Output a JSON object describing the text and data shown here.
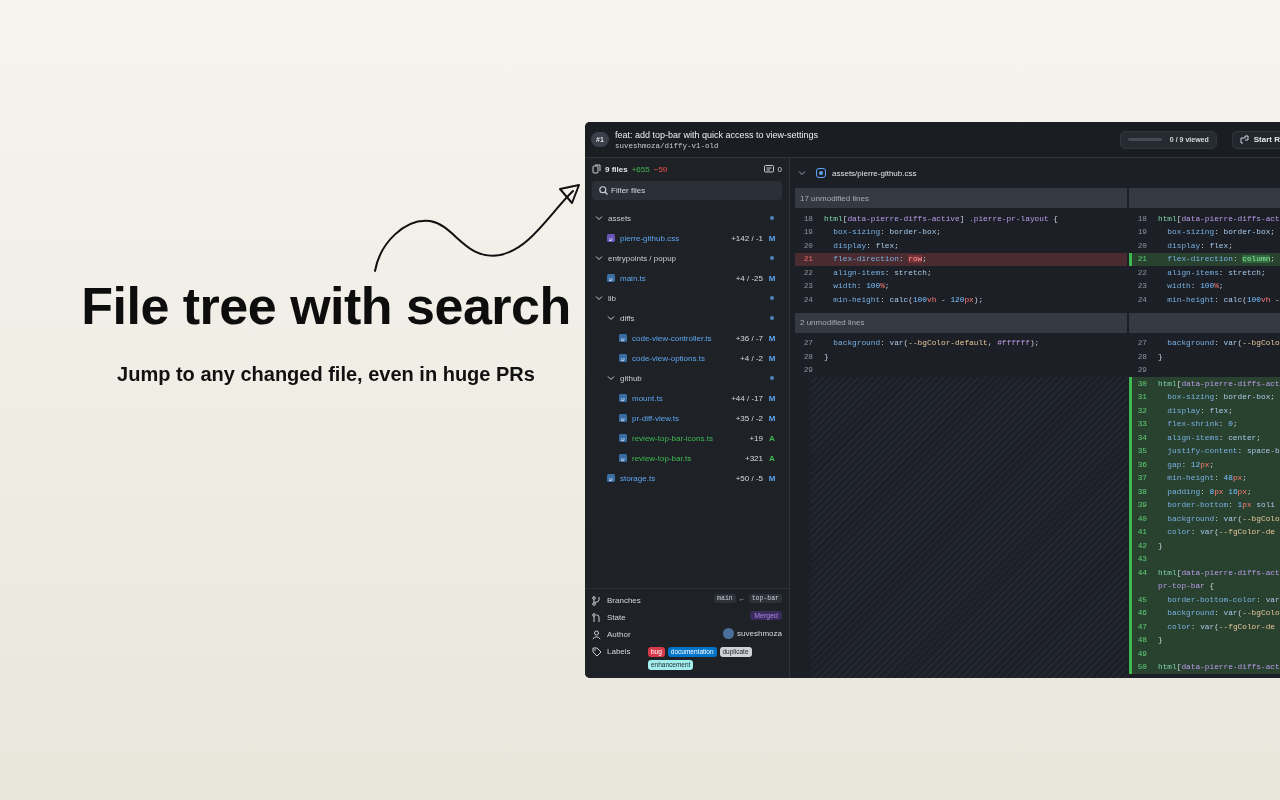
{
  "hero": {
    "title": "File tree with search",
    "subtitle": "Jump to any changed file, even in huge PRs"
  },
  "header": {
    "number": "#1",
    "title": "feat: add top-bar with quick access to view-settings",
    "repo": "suveshmoza/diffy-v1-old",
    "progress": {
      "level": 0,
      "label": "0 / 9 viewed"
    },
    "action": "Start R"
  },
  "sidebar": {
    "file_count": "9 files",
    "additions": "+655",
    "deletions": "−59",
    "comments": "0",
    "filter": {
      "placeholder": "Filter files"
    },
    "tree": [
      {
        "name": "assets",
        "kind": "folder",
        "expanded": true,
        "children": [
          {
            "name": "pierre-github.css",
            "kind": "stylesheet",
            "added": false,
            "stats": "+142 / -1",
            "status": "M"
          }
        ]
      },
      {
        "name": "entrypoints / popup",
        "kind": "folder",
        "expanded": true,
        "children": [
          {
            "name": "main.ts",
            "kind": "script",
            "added": false,
            "stats": "+4 / -25",
            "status": "M"
          }
        ]
      },
      {
        "name": "lib",
        "kind": "folder",
        "expanded": true,
        "children": [
          {
            "name": "diffs",
            "kind": "folder",
            "expanded": true,
            "children": [
              {
                "name": "code-view-controller.ts",
                "kind": "script",
                "added": false,
                "stats": "+36 / -7",
                "status": "M"
              },
              {
                "name": "code-view-options.ts",
                "kind": "script",
                "added": false,
                "stats": "+4 / -2",
                "status": "M"
              }
            ]
          },
          {
            "name": "github",
            "kind": "folder",
            "expanded": true,
            "children": [
              {
                "name": "mount.ts",
                "kind": "script",
                "added": false,
                "stats": "+44 / -17",
                "status": "M"
              },
              {
                "name": "pr-diff-view.ts",
                "kind": "script",
                "added": false,
                "stats": "+35 / -2",
                "status": "M"
              },
              {
                "name": "review-top-bar-icons.ts",
                "kind": "script",
                "added": true,
                "stats": "+19",
                "status": "A"
              },
              {
                "name": "review-top-bar.ts",
                "kind": "script",
                "added": true,
                "stats": "+321",
                "status": "A"
              }
            ]
          },
          {
            "name": "storage.ts",
            "kind": "script",
            "added": false,
            "stats": "+50 / -5",
            "status": "M"
          }
        ]
      }
    ],
    "details": [
      {
        "kind": "branches",
        "label": "Branches",
        "base": "main",
        "arrow": "←",
        "head": "top-bar"
      },
      {
        "kind": "state",
        "label": "State",
        "value": "Merged"
      },
      {
        "kind": "author",
        "label": "Author",
        "value": "suveshmoza"
      },
      {
        "kind": "labels",
        "label": "Labels",
        "labels": [
          {
            "text": "bug",
            "color": "#d73a4a"
          },
          {
            "text": "documentation",
            "color": "#0075ca"
          },
          {
            "text": "duplicate",
            "color": "#cfd3d7"
          },
          {
            "text": "enhancement",
            "color": "#a2eeef"
          }
        ]
      }
    ]
  },
  "diff": {
    "file": {
      "path": "assets/pierre-github.css",
      "expanded": true
    },
    "left": [
      {
        "kind": "collapsed",
        "label": "17 unmodified lines"
      },
      {
        "kind": "context",
        "n": "18",
        "t": [
          {
            "kind": "tag",
            "text": "html"
          },
          {
            "kind": "p",
            "text": "["
          },
          {
            "kind": "attr",
            "text": "data-pierre-diffs-active"
          },
          {
            "kind": "p",
            "text": "] "
          },
          {
            "kind": "cls",
            "text": ".pierre-pr-layout"
          },
          {
            "kind": "p",
            "text": " {"
          }
        ]
      },
      {
        "kind": "context",
        "n": "19",
        "t": [
          {
            "kind": "prop",
            "text": "  box-sizing"
          },
          {
            "kind": "p",
            "text": ": "
          },
          {
            "kind": "val",
            "text": "border-box"
          },
          {
            "kind": "p",
            "text": ";"
          }
        ]
      },
      {
        "kind": "context",
        "n": "20",
        "t": [
          {
            "kind": "prop",
            "text": "  display"
          },
          {
            "kind": "p",
            "text": ": "
          },
          {
            "kind": "val",
            "text": "flex"
          },
          {
            "kind": "p",
            "text": ";"
          }
        ]
      },
      {
        "kind": "deleted",
        "n": "21",
        "t": [
          {
            "kind": "prop",
            "text": "  flex-direction"
          },
          {
            "kind": "p",
            "text": ": "
          },
          {
            "kind": "del",
            "text": "row"
          },
          {
            "kind": "p",
            "text": ";"
          }
        ]
      },
      {
        "kind": "context",
        "n": "22",
        "t": [
          {
            "kind": "prop",
            "text": "  align-items"
          },
          {
            "kind": "p",
            "text": ": "
          },
          {
            "kind": "val",
            "text": "stretch"
          },
          {
            "kind": "p",
            "text": ";"
          }
        ]
      },
      {
        "kind": "context",
        "n": "23",
        "t": [
          {
            "kind": "prop",
            "text": "  width"
          },
          {
            "kind": "p",
            "text": ": "
          },
          {
            "kind": "num",
            "text": "100"
          },
          {
            "kind": "unit",
            "text": "%"
          },
          {
            "kind": "p",
            "text": ";"
          }
        ]
      },
      {
        "kind": "context",
        "n": "24",
        "t": [
          {
            "kind": "prop",
            "text": "  min-height"
          },
          {
            "kind": "p",
            "text": ": "
          },
          {
            "kind": "fn",
            "text": "calc"
          },
          {
            "kind": "p",
            "text": "("
          },
          {
            "kind": "num",
            "text": "100"
          },
          {
            "kind": "unit",
            "text": "vh"
          },
          {
            "kind": "p",
            "text": " - "
          },
          {
            "kind": "num",
            "text": "120"
          },
          {
            "kind": "unit",
            "text": "px"
          },
          {
            "kind": "p",
            "text": ");"
          }
        ]
      },
      {
        "kind": "collapsed",
        "label": "2 unmodified lines"
      },
      {
        "kind": "context",
        "n": "27",
        "t": [
          {
            "kind": "prop",
            "text": "  background"
          },
          {
            "kind": "p",
            "text": ": "
          },
          {
            "kind": "fn",
            "text": "var"
          },
          {
            "kind": "p",
            "text": "("
          },
          {
            "kind": "cvar",
            "text": "--bgColor-default"
          },
          {
            "kind": "p",
            "text": ", "
          },
          {
            "kind": "hex",
            "text": "#ffffff"
          },
          {
            "kind": "p",
            "text": ");"
          }
        ]
      },
      {
        "kind": "context",
        "n": "28",
        "t": [
          {
            "kind": "p",
            "text": "}"
          }
        ]
      },
      {
        "kind": "context",
        "n": "29"
      }
    ],
    "right": [
      {
        "kind": "collapsed"
      },
      {
        "kind": "context",
        "n": "18",
        "t": [
          {
            "kind": "tag",
            "text": "html"
          },
          {
            "kind": "p",
            "text": "["
          },
          {
            "kind": "attr",
            "text": "data-pierre-diffs-act"
          }
        ]
      },
      {
        "kind": "context",
        "n": "19",
        "t": [
          {
            "kind": "prop",
            "text": "  box-sizing"
          },
          {
            "kind": "p",
            "text": ": "
          },
          {
            "kind": "val",
            "text": "border-box"
          },
          {
            "kind": "p",
            "text": ";"
          }
        ]
      },
      {
        "kind": "context",
        "n": "20",
        "t": [
          {
            "kind": "prop",
            "text": "  display"
          },
          {
            "kind": "p",
            "text": ": "
          },
          {
            "kind": "val",
            "text": "flex"
          },
          {
            "kind": "p",
            "text": ";"
          }
        ]
      },
      {
        "kind": "added",
        "n": "21",
        "t": [
          {
            "kind": "prop",
            "text": "  flex-direction"
          },
          {
            "kind": "p",
            "text": ": "
          },
          {
            "kind": "ins",
            "text": "column"
          },
          {
            "kind": "p",
            "text": ";"
          }
        ]
      },
      {
        "kind": "context",
        "n": "22",
        "t": [
          {
            "kind": "prop",
            "text": "  align-items"
          },
          {
            "kind": "p",
            "text": ": "
          },
          {
            "kind": "val",
            "text": "stretch"
          },
          {
            "kind": "p",
            "text": ";"
          }
        ]
      },
      {
        "kind": "context",
        "n": "23",
        "t": [
          {
            "kind": "prop",
            "text": "  width"
          },
          {
            "kind": "p",
            "text": ": "
          },
          {
            "kind": "num",
            "text": "100"
          },
          {
            "kind": "unit",
            "text": "%"
          },
          {
            "kind": "p",
            "text": ";"
          }
        ]
      },
      {
        "kind": "context",
        "n": "24",
        "t": [
          {
            "kind": "prop",
            "text": "  min-height"
          },
          {
            "kind": "p",
            "text": ": "
          },
          {
            "kind": "fn",
            "text": "calc"
          },
          {
            "kind": "p",
            "text": "("
          },
          {
            "kind": "num",
            "text": "100"
          },
          {
            "kind": "unit",
            "text": "vh"
          },
          {
            "kind": "p",
            "text": " -"
          }
        ]
      },
      {
        "kind": "collapsed"
      },
      {
        "kind": "context",
        "n": "27",
        "t": [
          {
            "kind": "prop",
            "text": "  background"
          },
          {
            "kind": "p",
            "text": ": "
          },
          {
            "kind": "fn",
            "text": "var"
          },
          {
            "kind": "p",
            "text": "("
          },
          {
            "kind": "cvar",
            "text": "--bgColo"
          }
        ]
      },
      {
        "kind": "context",
        "n": "28",
        "t": [
          {
            "kind": "p",
            "text": "}"
          }
        ]
      },
      {
        "kind": "context",
        "n": "29"
      },
      {
        "kind": "added",
        "n": "30",
        "t": [
          {
            "kind": "tag",
            "text": "html"
          },
          {
            "kind": "p",
            "text": "["
          },
          {
            "kind": "attr",
            "text": "data-pierre-diffs-act"
          }
        ]
      },
      {
        "kind": "added",
        "n": "31",
        "t": [
          {
            "kind": "prop",
            "text": "  box-sizing"
          },
          {
            "kind": "p",
            "text": ": "
          },
          {
            "kind": "val",
            "text": "border-box"
          },
          {
            "kind": "p",
            "text": ";"
          }
        ]
      },
      {
        "kind": "added",
        "n": "32",
        "t": [
          {
            "kind": "prop",
            "text": "  display"
          },
          {
            "kind": "p",
            "text": ": "
          },
          {
            "kind": "val",
            "text": "flex"
          },
          {
            "kind": "p",
            "text": ";"
          }
        ]
      },
      {
        "kind": "added",
        "n": "33",
        "t": [
          {
            "kind": "prop",
            "text": "  flex-shrink"
          },
          {
            "kind": "p",
            "text": ": "
          },
          {
            "kind": "num",
            "text": "0"
          },
          {
            "kind": "p",
            "text": ";"
          }
        ]
      },
      {
        "kind": "added",
        "n": "34",
        "t": [
          {
            "kind": "prop",
            "text": "  align-items"
          },
          {
            "kind": "p",
            "text": ": "
          },
          {
            "kind": "val",
            "text": "center"
          },
          {
            "kind": "p",
            "text": ";"
          }
        ]
      },
      {
        "kind": "added",
        "n": "35",
        "t": [
          {
            "kind": "prop",
            "text": "  justify-content"
          },
          {
            "kind": "p",
            "text": ": "
          },
          {
            "kind": "val",
            "text": "space-b"
          }
        ]
      },
      {
        "kind": "added",
        "n": "36",
        "t": [
          {
            "kind": "prop",
            "text": "  gap"
          },
          {
            "kind": "p",
            "text": ": "
          },
          {
            "kind": "num",
            "text": "12"
          },
          {
            "kind": "unit",
            "text": "px"
          },
          {
            "kind": "p",
            "text": ";"
          }
        ]
      },
      {
        "kind": "added",
        "n": "37",
        "t": [
          {
            "kind": "prop",
            "text": "  min-height"
          },
          {
            "kind": "p",
            "text": ": "
          },
          {
            "kind": "num",
            "text": "48"
          },
          {
            "kind": "unit",
            "text": "px"
          },
          {
            "kind": "p",
            "text": ";"
          }
        ]
      },
      {
        "kind": "added",
        "n": "38",
        "t": [
          {
            "kind": "prop",
            "text": "  padding"
          },
          {
            "kind": "p",
            "text": ": "
          },
          {
            "kind": "num",
            "text": "8"
          },
          {
            "kind": "unit",
            "text": "px"
          },
          {
            "kind": "num",
            "text": " 16"
          },
          {
            "kind": "unit",
            "text": "px"
          },
          {
            "kind": "p",
            "text": ";"
          }
        ]
      },
      {
        "kind": "added",
        "n": "39",
        "t": [
          {
            "kind": "prop",
            "text": "  border-bottom"
          },
          {
            "kind": "p",
            "text": ": "
          },
          {
            "kind": "num",
            "text": "1"
          },
          {
            "kind": "unit",
            "text": "px"
          },
          {
            "kind": "val",
            "text": " soli"
          }
        ]
      },
      {
        "kind": "added",
        "n": "40",
        "t": [
          {
            "kind": "prop",
            "text": "  background"
          },
          {
            "kind": "p",
            "text": ": "
          },
          {
            "kind": "fn",
            "text": "var"
          },
          {
            "kind": "p",
            "text": "("
          },
          {
            "kind": "cvar",
            "text": "--bgColo"
          }
        ]
      },
      {
        "kind": "added",
        "n": "41",
        "t": [
          {
            "kind": "prop",
            "text": "  color"
          },
          {
            "kind": "p",
            "text": ": "
          },
          {
            "kind": "fn",
            "text": "var"
          },
          {
            "kind": "p",
            "text": "("
          },
          {
            "kind": "cvar",
            "text": "--fgColor-de"
          }
        ]
      },
      {
        "kind": "added",
        "n": "42",
        "t": [
          {
            "kind": "p",
            "text": "}"
          }
        ]
      },
      {
        "kind": "added",
        "n": "43"
      },
      {
        "kind": "added",
        "n": "44",
        "t": [
          {
            "kind": "tag",
            "text": "html"
          },
          {
            "kind": "p",
            "text": "["
          },
          {
            "kind": "attr",
            "text": "data-pierre-diffs-act"
          }
        ]
      },
      {
        "kind": "added",
        "t": [
          {
            "kind": "cls",
            "text": "pr-top-bar"
          },
          {
            "kind": "p",
            "text": " {"
          }
        ]
      },
      {
        "kind": "added",
        "n": "45",
        "t": [
          {
            "kind": "prop",
            "text": "  border-bottom-color"
          },
          {
            "kind": "p",
            "text": ": "
          },
          {
            "kind": "fn",
            "text": "var"
          }
        ]
      },
      {
        "kind": "added",
        "n": "46",
        "t": [
          {
            "kind": "prop",
            "text": "  background"
          },
          {
            "kind": "p",
            "text": ": "
          },
          {
            "kind": "fn",
            "text": "var"
          },
          {
            "kind": "p",
            "text": "("
          },
          {
            "kind": "cvar",
            "text": "--bgColo"
          }
        ]
      },
      {
        "kind": "added",
        "n": "47",
        "t": [
          {
            "kind": "prop",
            "text": "  color"
          },
          {
            "kind": "p",
            "text": ": "
          },
          {
            "kind": "fn",
            "text": "var"
          },
          {
            "kind": "p",
            "text": "("
          },
          {
            "kind": "cvar",
            "text": "--fgColor-de"
          }
        ]
      },
      {
        "kind": "added",
        "n": "48",
        "t": [
          {
            "kind": "p",
            "text": "}"
          }
        ]
      },
      {
        "kind": "added",
        "n": "49"
      },
      {
        "kind": "added",
        "n": "50",
        "t": [
          {
            "kind": "tag",
            "text": "html"
          },
          {
            "kind": "p",
            "text": "["
          },
          {
            "kind": "attr",
            "text": "data-pierre-diffs-act"
          }
        ]
      }
    ]
  }
}
